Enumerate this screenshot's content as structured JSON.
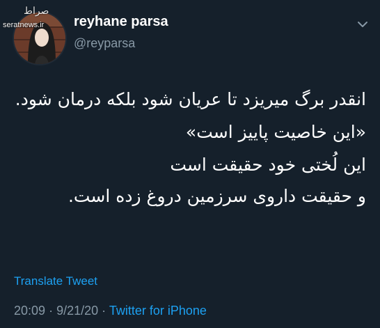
{
  "tweet": {
    "author": {
      "name": "reyhane parsa",
      "handle": "@reyparsa",
      "avatar_icon": "user-avatar"
    },
    "body_lines": [
      "انقدر برگ میریزد تا عریان شود بلکه درمان شود.",
      "«این خاصیت پاییز است»",
      "این لُختی خود حقیقت است",
      "و حقیقت داروی سرزمین دروغ زده است."
    ],
    "translate_label": "Translate Tweet",
    "time": "20:09",
    "separator": "·",
    "date": "9/21/20",
    "source": "Twitter for iPhone",
    "menu_icon": "chevron-down-icon"
  },
  "watermark": {
    "logo": "صراط",
    "url": "seratnews.ir"
  },
  "colors": {
    "background": "#15202b",
    "text": "#ffffff",
    "secondary": "#8899a6",
    "accent": "#1da1f2"
  }
}
